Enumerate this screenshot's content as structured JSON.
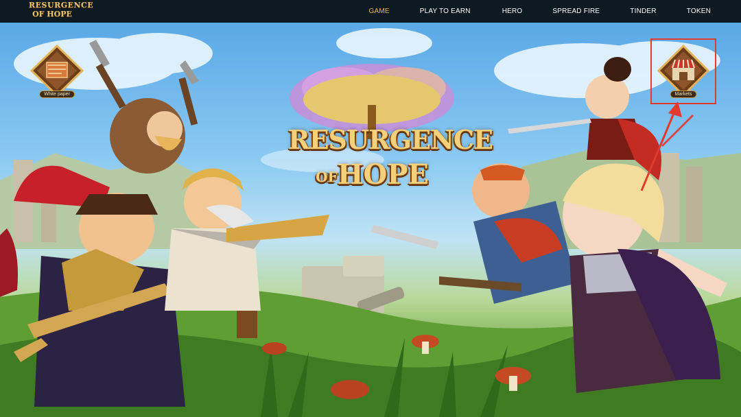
{
  "header": {
    "logo": {
      "line1": "RESURGENCE",
      "line2": "OF HOPE"
    },
    "nav": [
      {
        "label": "GAME",
        "active": true
      },
      {
        "label": "PLAY TO EARN",
        "active": false
      },
      {
        "label": "HERO",
        "active": false
      },
      {
        "label": "SPREAD FIRE",
        "active": false
      },
      {
        "label": "TINDER",
        "active": false
      },
      {
        "label": "TOKEN",
        "active": false
      }
    ]
  },
  "hero": {
    "title_line1": "RESURGENCE",
    "title_of": "OF",
    "title_line2": "HOPE"
  },
  "badges": {
    "white_paper": {
      "label": "White paper",
      "icon": "document-icon"
    },
    "markets": {
      "label": "Markets",
      "icon": "market-stall-icon"
    }
  },
  "colors": {
    "nav_bg": "#0e1a22",
    "nav_active": "#f2b84a",
    "highlight": "#e23b2e"
  }
}
